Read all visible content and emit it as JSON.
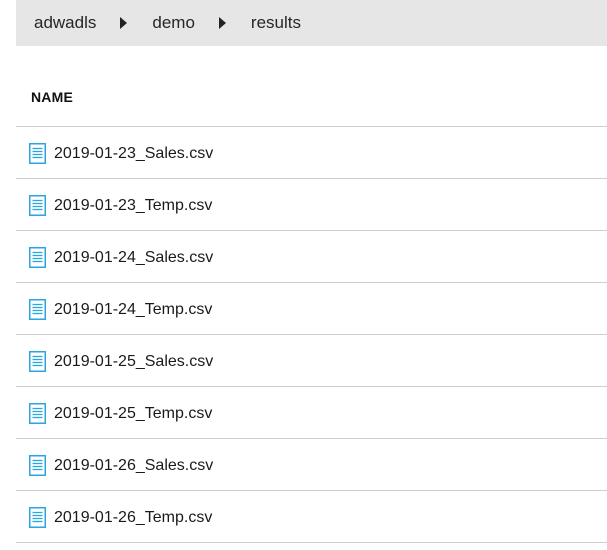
{
  "breadcrumb": {
    "items": [
      "adwadls",
      "demo",
      "results"
    ]
  },
  "table": {
    "column_header": "NAME",
    "icon": "file-text-icon",
    "icon_color": "#2aa7e0",
    "files": [
      "2019-01-23_Sales.csv",
      "2019-01-23_Temp.csv",
      "2019-01-24_Sales.csv",
      "2019-01-24_Temp.csv",
      "2019-01-25_Sales.csv",
      "2019-01-25_Temp.csv",
      "2019-01-26_Sales.csv",
      "2019-01-26_Temp.csv"
    ]
  }
}
